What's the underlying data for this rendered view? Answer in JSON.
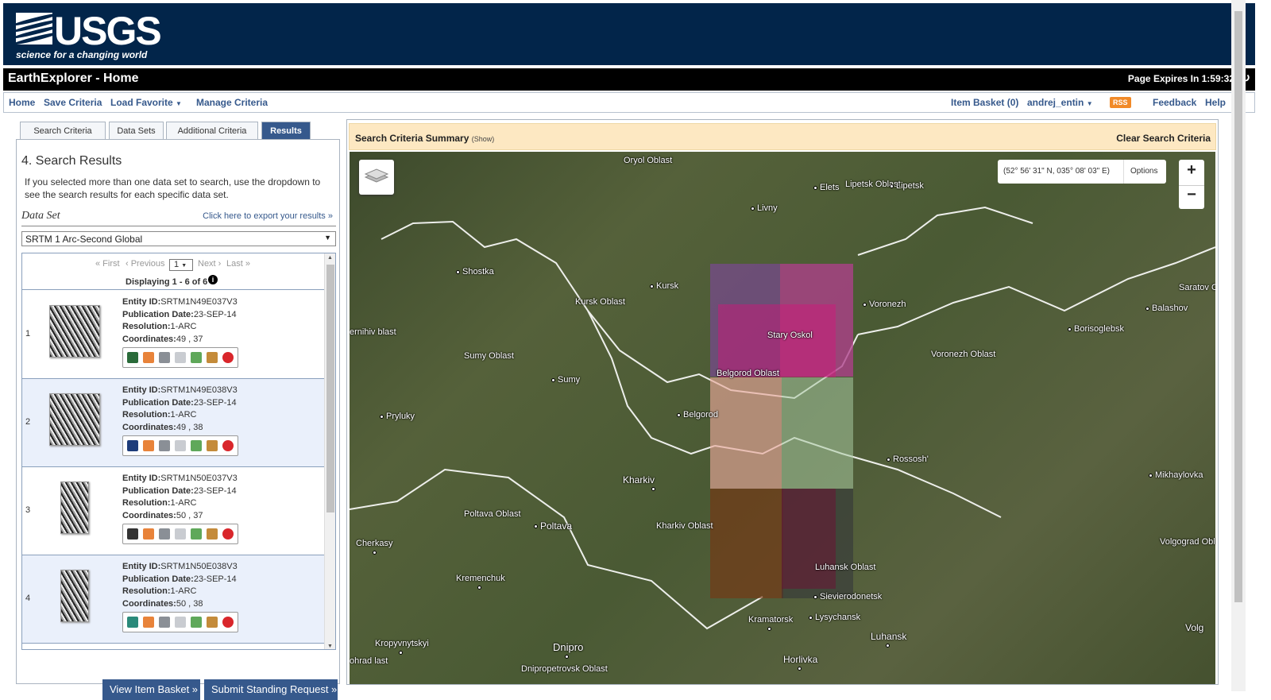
{
  "header": {
    "logo_word": "USGS",
    "logo_tagline": "science for a changing world"
  },
  "titlebar": {
    "title": "EarthExplorer - Home",
    "expires": "Page Expires In 1:59:32",
    "refresh_icon": "refresh-icon"
  },
  "nav": {
    "home": "Home",
    "save": "Save Criteria",
    "load": "Load Favorite",
    "manage": "Manage Criteria",
    "basket": "Item Basket (0)",
    "user": "andrej_entin",
    "rss": "RSS",
    "feedback": "Feedback",
    "help": "Help"
  },
  "tabs": [
    "Search Criteria",
    "Data Sets",
    "Additional Criteria",
    "Results"
  ],
  "results": {
    "title": "4. Search Results",
    "desc": "If you selected more than one data set to search, use the dropdown to see the search results for each specific data set.",
    "dataset_label": "Data Set",
    "export_link": "Click here to export your results »",
    "dataset_value": "SRTM 1 Arc-Second Global",
    "pager": {
      "first": "« First",
      "prev": "‹ Previous",
      "page": "1",
      "next": "Next ›",
      "last": "Last »",
      "displaying": "Displaying 1 - 6 of 6"
    },
    "labels": {
      "entity": "Entity ID:",
      "pubdate": "Publication Date:",
      "resolution": "Resolution:",
      "coords": "Coordinates:"
    },
    "items": [
      {
        "num": "1",
        "entity": "SRTM1N49E037V3",
        "pubdate": "23-SEP-14",
        "resolution": "1-ARC",
        "coords": "49 , 37"
      },
      {
        "num": "2",
        "entity": "SRTM1N49E038V3",
        "pubdate": "23-SEP-14",
        "resolution": "1-ARC",
        "coords": "49 , 38"
      },
      {
        "num": "3",
        "entity": "SRTM1N50E037V3",
        "pubdate": "23-SEP-14",
        "resolution": "1-ARC",
        "coords": "50 , 37"
      },
      {
        "num": "4",
        "entity": "SRTM1N50E038V3",
        "pubdate": "23-SEP-14",
        "resolution": "1-ARC",
        "coords": "50 , 38"
      }
    ],
    "buttons": {
      "basket": "View Item Basket »",
      "standing": "Submit Standing Request »"
    }
  },
  "map": {
    "summary_title": "Search Criteria Summary",
    "summary_show": "(Show)",
    "clear": "Clear Search Criteria",
    "coords": "(52° 56' 31\" N, 035° 08' 03\" E)",
    "options": "Options",
    "zoom_in": "+",
    "zoom_out": "−",
    "labels": {
      "oryol": "Oryol Oblast",
      "elets": "Elets",
      "lipetsk_obl": "Lipetsk Oblast",
      "lipetsk": "Lipetsk",
      "livny": "Livny",
      "shostka": "Shostka",
      "kursk": "Kursk",
      "kursk_obl": "Kursk Oblast",
      "voronezh": "Voronezh",
      "saratov": "Saratov Oblast",
      "balashov": "Balashov",
      "nihiv": "ernihiv blast",
      "sumy_obl": "Sumy Oblast",
      "stary": "Stary Oskol",
      "borisoglebsk": "Borisoglebsk",
      "voronezh_obl": "Voronezh Oblast",
      "belgorod_obl": "Belgorod Oblast",
      "sumy": "Sumy",
      "pryluky": "Pryluky",
      "belgorod": "Belgorod",
      "rossosh": "Rossosh'",
      "mikhaylovka": "Mikhaylovka",
      "kharkiv": "Kharkiv",
      "poltava_obl": "Poltava Oblast",
      "poltava": "Poltava",
      "kharkiv_obl": "Kharkiv Oblast",
      "cherkasy": "Cherkasy",
      "volgograd_obl": "Volgograd Oblast",
      "kremenchuk": "Kremenchuk",
      "luhansk_obl": "Luhansk Oblast",
      "sievierodonetsk": "Sievierodonetsk",
      "kramatorsk": "Kramatorsk",
      "lysychansk": "Lysychansk",
      "luhansk": "Luhansk",
      "kropyvnytskyi": "Kropyvnytskyi",
      "dnipro": "Dnipro",
      "horlivka": "Horlivka",
      "ohrad": "ohrad last",
      "dnipro_obl": "Dnipropetrovsk Oblast",
      "volg": "Volg"
    }
  }
}
